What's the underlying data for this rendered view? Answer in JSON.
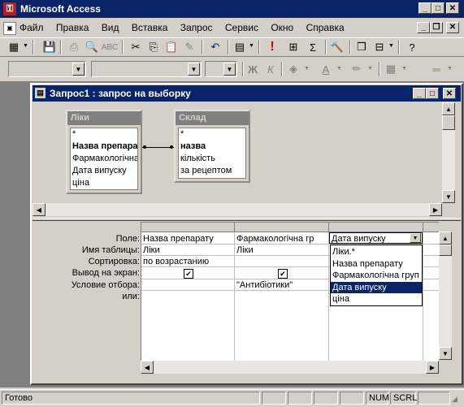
{
  "app": {
    "title": "Microsoft Access"
  },
  "menu": [
    "Файл",
    "Правка",
    "Вид",
    "Вставка",
    "Запрос",
    "Сервис",
    "Окно",
    "Справка"
  ],
  "toolbar": {
    "icons": [
      "view-icon",
      "save-icon",
      "print-icon",
      "print-preview-icon",
      "spellcheck-icon",
      "cut-icon",
      "copy-icon",
      "paste-icon",
      "format-painter-icon",
      "undo-icon",
      "query-type-icon",
      "run-icon",
      "show-table-icon",
      "totals-icon",
      "builder-icon",
      "database-window-icon",
      "new-object-icon",
      "help-icon"
    ],
    "bold": "Ж",
    "italic": "К"
  },
  "query_window": {
    "title": "Запрос1 : запрос на выборку"
  },
  "tables": [
    {
      "name": "Ліки",
      "fields": [
        "*",
        "Назва препарат",
        "Фармакологічна",
        "Дата випуску",
        "ціна"
      ]
    },
    {
      "name": "Склад",
      "fields": [
        "*",
        "назва",
        "кількість",
        "за рецептом"
      ]
    }
  ],
  "grid": {
    "row_labels": [
      "Поле:",
      "Имя таблицы:",
      "Сортировка:",
      "Вывод на экран:",
      "Условие отбора:",
      "или:"
    ],
    "columns": [
      {
        "field": "Назва препарату",
        "table": "Ліки",
        "sort": "по возрастанию",
        "show": true,
        "criteria": ""
      },
      {
        "field": "Фармакологічна гр",
        "table": "Ліки",
        "sort": "",
        "show": true,
        "criteria": "\"Антибіотики\""
      },
      {
        "field": "Дата випуску",
        "table": "",
        "sort": "",
        "show": false,
        "criteria": ""
      }
    ],
    "dropdown_options": [
      "Ліки.*",
      "Назва препарату",
      "Фармакологічна груп",
      "Дата випуску",
      "ціна"
    ],
    "dropdown_selected": "Дата випуску"
  },
  "status": {
    "text": "Готово",
    "num": "NUM",
    "scrl": "SCRL"
  },
  "colors": {
    "title_active": "#0a246a",
    "title_inactive": "#808080",
    "face": "#d4d0c8",
    "run": "#d40000"
  }
}
